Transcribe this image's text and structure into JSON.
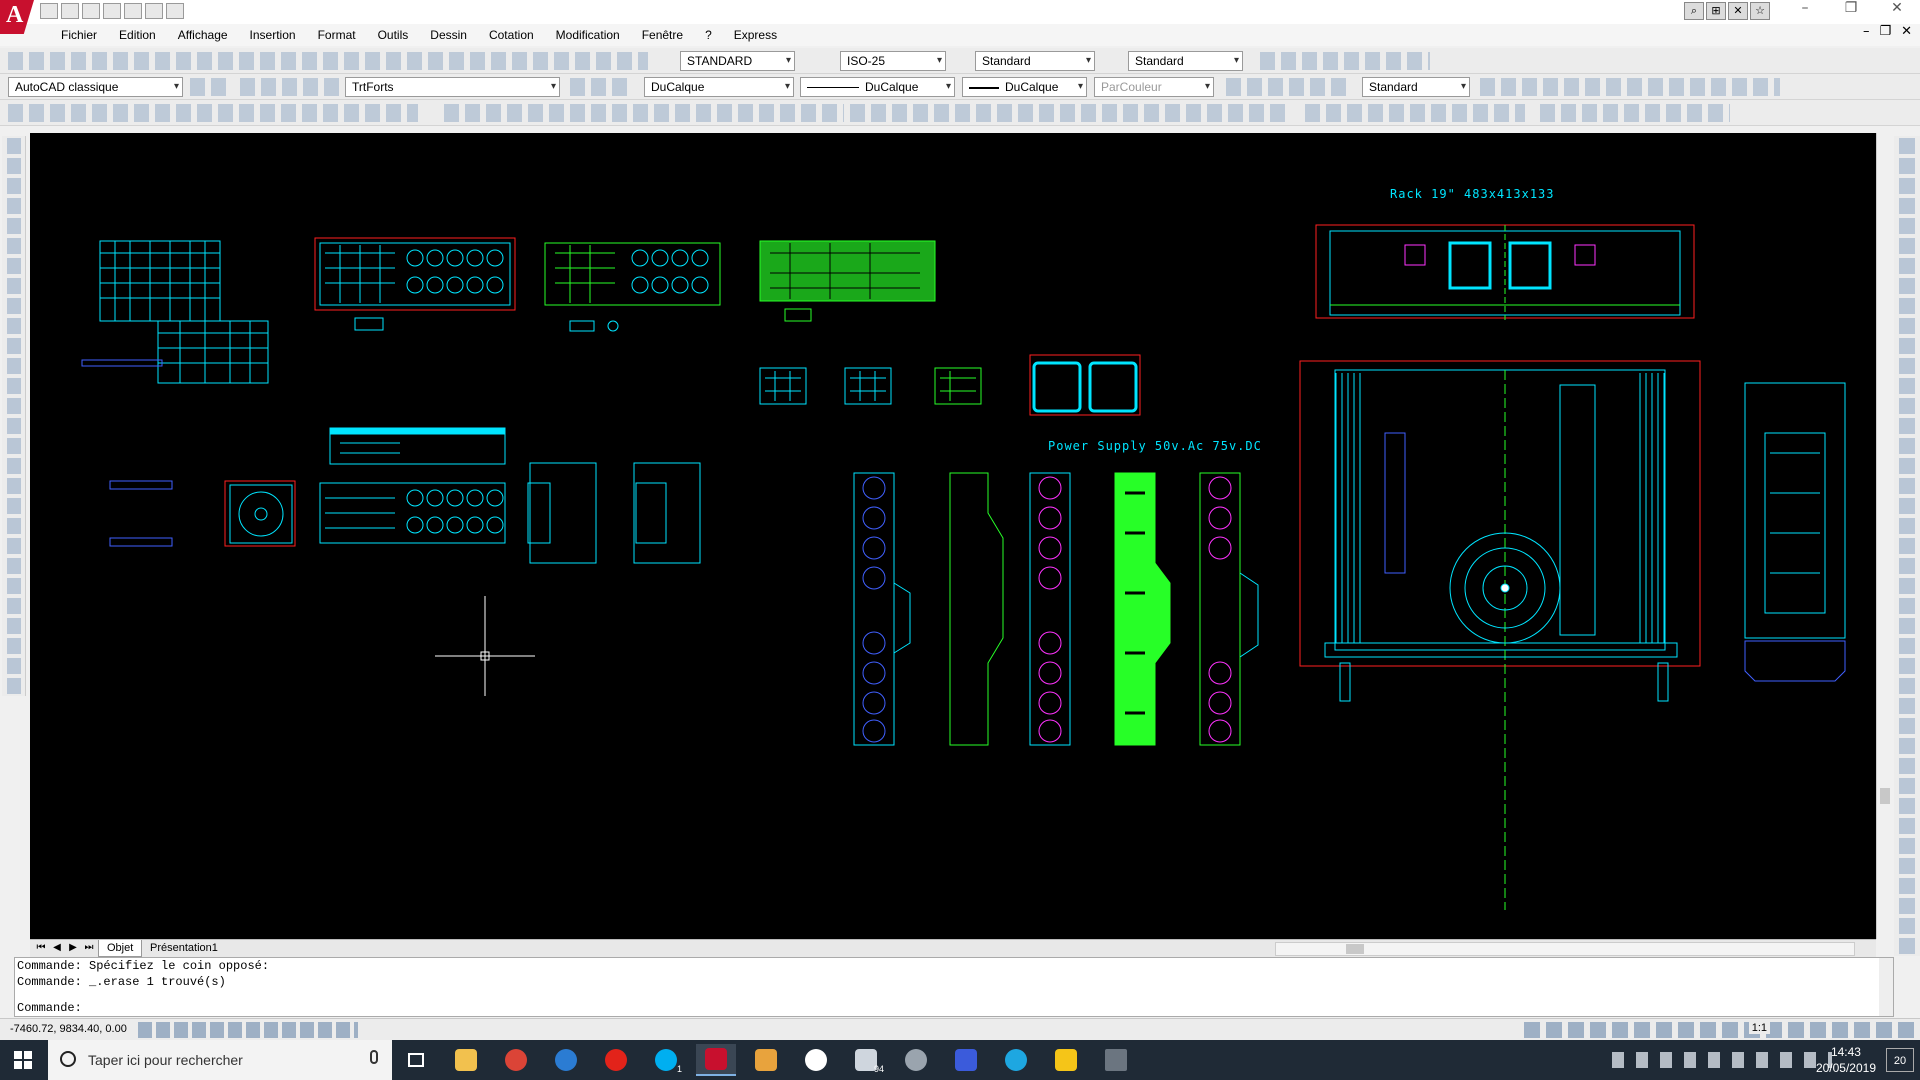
{
  "title_bar": {
    "app_logo": "A"
  },
  "menu": [
    "Fichier",
    "Edition",
    "Affichage",
    "Insertion",
    "Format",
    "Outils",
    "Dessin",
    "Cotation",
    "Modification",
    "Fenêtre",
    "?",
    "Express"
  ],
  "toolbar1": {
    "text_style": "STANDARD",
    "dim_style": "ISO-25",
    "table_style": "Standard",
    "multileader_style": "Standard"
  },
  "toolbar2": {
    "workspace": "AutoCAD classique",
    "layer": "TrtForts",
    "color": "DuCalque",
    "linetype": "DuCalque",
    "lineweight": "DuCalque",
    "plotstyle": "ParCouleur",
    "visual_style": "Standard"
  },
  "drawing": {
    "rack_label": "Rack 19\" 483x413x133",
    "psu_label": "Power Supply 50v.Ac 75v.DC",
    "colors": {
      "cyan": "#00e5ff",
      "green": "#27ff27",
      "red": "#ff2020",
      "magenta": "#ff33ff",
      "blue": "#4060ff",
      "white": "#ffffff"
    }
  },
  "layout_tabs": [
    "Objet",
    "Présentation1"
  ],
  "command": {
    "history": [
      "Commande: Spécifiez le coin opposé:",
      "Commande: _.erase 1 trouvé(s)"
    ],
    "prompt": "Commande:"
  },
  "status": {
    "coords": "-7460.72, 9834.40, 0.00",
    "scale": "1:1"
  },
  "taskbar": {
    "search_placeholder": "Taper ici pour rechercher",
    "time": "14:43",
    "date": "20/05/2019",
    "notifications": "20",
    "mail_badge": "94",
    "skype_badge": "1"
  }
}
